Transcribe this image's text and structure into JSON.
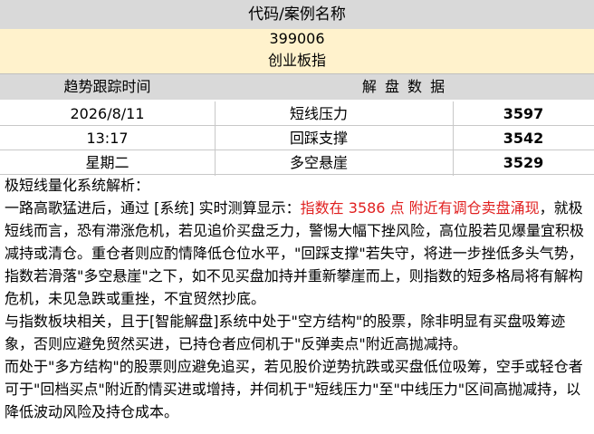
{
  "header": {
    "title": "代码/案例名称"
  },
  "instrument": {
    "code": "399006",
    "name": "创业板指"
  },
  "table_header": {
    "left": "趋势跟踪时间",
    "right": "解 盘 数 据"
  },
  "rows": [
    {
      "time": "2026/8/11",
      "label": "短线压力",
      "value": "3597"
    },
    {
      "time": "13:17",
      "label": "回踩支撑",
      "value": "3542"
    },
    {
      "time": "星期二",
      "label": "多空悬崖",
      "value": "3529"
    }
  ],
  "analysis": {
    "heading": "极短线量化系统解析：",
    "intro": "一路高歌猛进后，通过 [系统] 实时测算显示：",
    "highlight": "指数在 3586 点 附近有调仓卖盘涌现",
    "body1": "，就极短线而言，恐有滞涨危机，若见追价买盘乏力，警惕大幅下挫风险，高位股若见爆量宜积极减持或清仓。重仓者则应酌情降低仓位水平，\"回踩支撑\"若失守，将进一步挫低多头气势，指数若滑落\"多空悬崖\"之下，如不见买盘加持并重新攀崖而上，则指数的短多格局将有解构危机，未见急跌或重挫，不宜贸然抄底。",
    "body2": "与指数板块相关，且于[智能解盘]系统中处于\"空方结构\"的股票，除非明显有买盘吸筹迹象，否则应避免贸然买进，已持仓者应伺机于\"反弹卖点\"附近高抛减持。",
    "body3": "而处于\"多方结构\"的股票则应避免追买，若见股价逆势抗跌或买盘低位吸筹，空手或轻仓者可于\"回档买点\"附近酌情买进或增持，并伺机于\"短线压力\"至\"中线压力\"区间高抛减持，以降低波动风险及持仓成本。"
  }
}
